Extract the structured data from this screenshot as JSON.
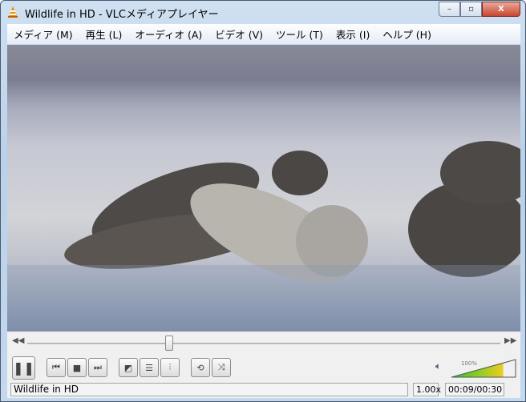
{
  "window": {
    "title": "Wildlife in HD - VLCメディアプレイヤー",
    "minimize": "–",
    "maximize": "▫",
    "close": "X"
  },
  "menu": [
    "メディア (M)",
    "再生 (L)",
    "オーディオ (A)",
    "ビデオ (V)",
    "ツール (T)",
    "表示 (I)",
    "ヘルプ (H)"
  ],
  "playback": {
    "position_fraction": 0.3
  },
  "volume": {
    "label": "100%",
    "level_percent": 100
  },
  "status": {
    "title": "Wildlife in HD",
    "speed": "1.00x",
    "time": "00:09/00:30"
  }
}
